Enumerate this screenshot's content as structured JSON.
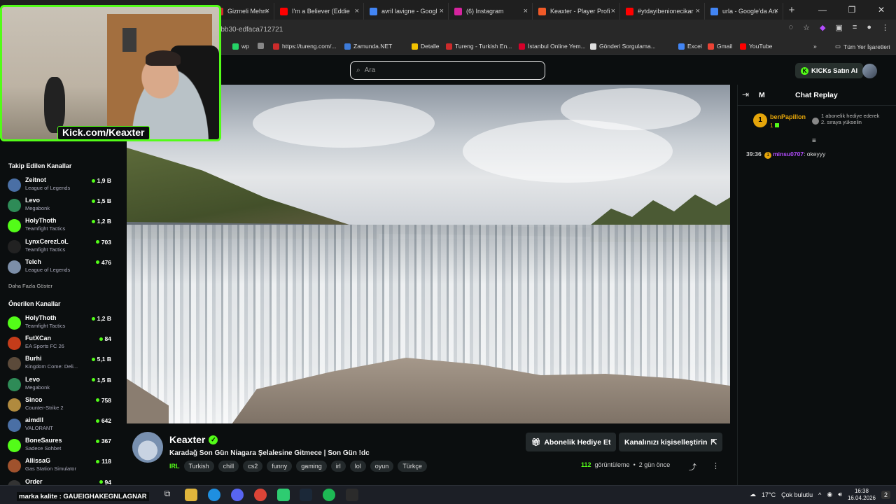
{
  "browser": {
    "tabs": [
      {
        "label": "Gizmeli Mehmet",
        "color": "#cc2b2b"
      },
      {
        "label": "I'm a Believer (Eddie",
        "color": "#ff0000"
      },
      {
        "label": "avril lavigne - Googl",
        "color": "#4285f4"
      },
      {
        "label": "(6) Instagram",
        "color": "#d6249f"
      },
      {
        "label": "Keaxter - Player Profi",
        "color": "#f05a28"
      },
      {
        "label": "#ytdayibenionecikar",
        "color": "#ff0000"
      },
      {
        "label": "urla - Google'da Ara",
        "color": "#4285f4"
      }
    ],
    "url": "-bb30-edfaca712721",
    "bookmarks": [
      {
        "label": "wp",
        "color": "#25d366"
      },
      {
        "label": "",
        "color": "#888888"
      },
      {
        "label": "https://tureng.com/...",
        "color": "#cc2b2b"
      },
      {
        "label": "Zamunda.NET",
        "color": "#3d7bd9"
      },
      {
        "label": "Detalle",
        "color": "#f2c200"
      },
      {
        "label": "Tureng - Turkish En...",
        "color": "#cc2b2b"
      },
      {
        "label": "İstanbul Online Yem...",
        "color": "#d6002a"
      },
      {
        "label": "Gönderi Sorgulama...",
        "color": "#dddddd"
      },
      {
        "label": "Excel",
        "color": "#4285f4"
      },
      {
        "label": "Gmail",
        "color": "#ea4335"
      },
      {
        "label": "YouTube",
        "color": "#ff0000"
      }
    ],
    "all_bookmarks": "Tüm Yer İşaretleri"
  },
  "topbar": {
    "search_placeholder": "Ara",
    "kicks_button": "KICKs Satın Al"
  },
  "webcam": {
    "label": "Kick.com/Keaxter"
  },
  "sidebar": {
    "followed_title": "Takip Edilen Kanallar",
    "followed": [
      {
        "name": "Zeitnot",
        "category": "League of Legends",
        "viewers": "1,9 B",
        "color": "#4a6fa5"
      },
      {
        "name": "Levo",
        "category": "Megabonk",
        "viewers": "1,5 B",
        "color": "#2e8b57"
      },
      {
        "name": "HolyThoth",
        "category": "Teamfight Tactics",
        "viewers": "1,2 B",
        "color": "#53fc18"
      },
      {
        "name": "LynxCerezLoL",
        "category": "Teamfight Tactics",
        "viewers": "703",
        "color": "#222222"
      },
      {
        "name": "Telch",
        "category": "League of Legends",
        "viewers": "476",
        "color": "#7c8ea8"
      }
    ],
    "show_more": "Daha Fazla Göster",
    "recommended_title": "Önerilen Kanallar",
    "recommended": [
      {
        "name": "HolyThoth",
        "category": "Teamfight Tactics",
        "viewers": "1,2 B",
        "color": "#53fc18"
      },
      {
        "name": "FutXCan",
        "category": "EA Sports FC 26",
        "viewers": "84",
        "color": "#c43c1a"
      },
      {
        "name": "Burhi",
        "category": "Kingdom Come: Deli...",
        "viewers": "5,1 B",
        "color": "#5b4a3a"
      },
      {
        "name": "Levo",
        "category": "Megabonk",
        "viewers": "1,5 B",
        "color": "#2e8b57"
      },
      {
        "name": "Sinco",
        "category": "Counter-Strike 2",
        "viewers": "758",
        "color": "#b08a3e"
      },
      {
        "name": "aimdll",
        "category": "VALORANT",
        "viewers": "642",
        "color": "#4a6fa5"
      },
      {
        "name": "BoneSaures",
        "category": "Sadece Sohbet",
        "viewers": "367",
        "color": "#53fc18"
      },
      {
        "name": "AllissaG",
        "category": "Gas Station Simulator",
        "viewers": "118",
        "color": "#a0522d"
      },
      {
        "name": "Order",
        "category": "",
        "viewers": "94",
        "color": "#333333"
      }
    ]
  },
  "chat": {
    "title": "Chat Replay",
    "tab_letter": "M",
    "pinned": {
      "rank": "1",
      "user": "benPapillon",
      "sub": "1",
      "message": "1 abonelik hediye ederek 2. sıraya yükselin"
    },
    "messages": [
      {
        "time": "39:36",
        "badge": "1",
        "user": "minsu0707",
        "text": ": okeyyy"
      }
    ]
  },
  "stream": {
    "streamer": "Keaxter",
    "title": "Karadağ Son Gün Niagara Şelalesine Gitmece | Son Gün !dc",
    "category": "IRL",
    "tags": [
      "Turkish",
      "chill",
      "cs2",
      "funny",
      "gaming",
      "irl",
      "lol",
      "oyun",
      "Türkçe"
    ],
    "gift_sub_button": "Abonelik Hediye Et",
    "customize_button": "Kanalınızı kişiselleştirin",
    "views_count": "112",
    "views_label": "görüntüleme",
    "separator": "•",
    "ago": "2 gün önce"
  },
  "taskbar": {
    "overlay_text": "marka kalite : GAUEIGHAKEGNLAGNAR",
    "weather_temp": "17°C",
    "weather_text": "Çok bulutlu",
    "time": "16:38",
    "date": "16.04.2026",
    "notifications": "2"
  }
}
